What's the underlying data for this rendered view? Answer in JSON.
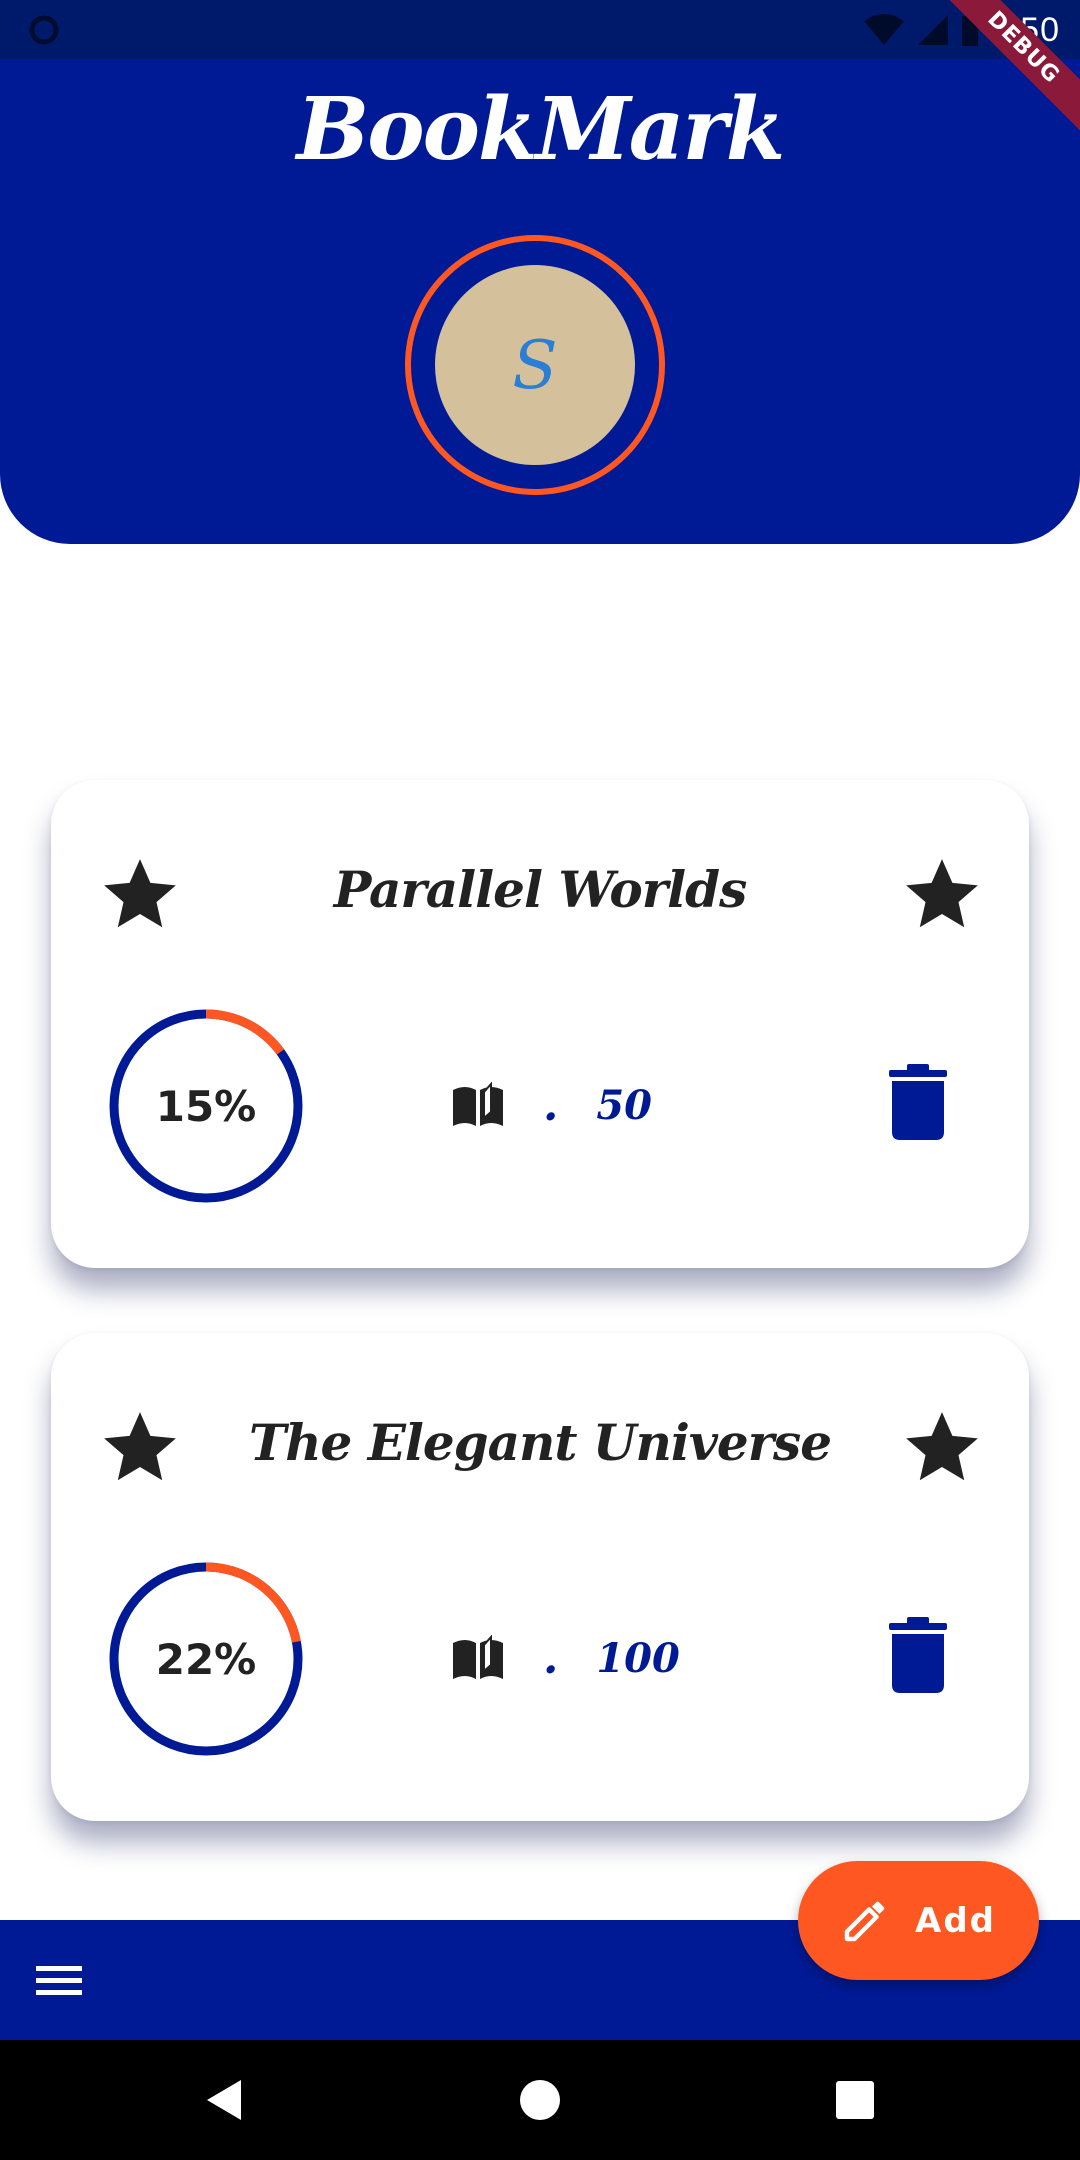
{
  "status_bar": {
    "time": "8:50"
  },
  "debug_banner": "DEBUG",
  "header": {
    "title": "BookMark",
    "avatar_initial": "S"
  },
  "books": [
    {
      "title": "Parallel Worlds",
      "progress_label": "15%",
      "progress": 0.15,
      "separator": ".",
      "pages": "50"
    },
    {
      "title": "The Elegant Universe",
      "progress_label": "22%",
      "progress": 0.22,
      "separator": ".",
      "pages": "100"
    }
  ],
  "fab": {
    "label": "Add"
  },
  "colors": {
    "primary": "#001a96",
    "accent": "#ff5722",
    "avatar_bg": "#d5c09c",
    "initial": "#2a7fd4",
    "debug": "#8b1a3a"
  },
  "icons": {
    "star": "star-icon",
    "book": "book-icon",
    "trash": "trash-icon",
    "pencil": "pencil-icon",
    "menu": "menu-icon"
  }
}
